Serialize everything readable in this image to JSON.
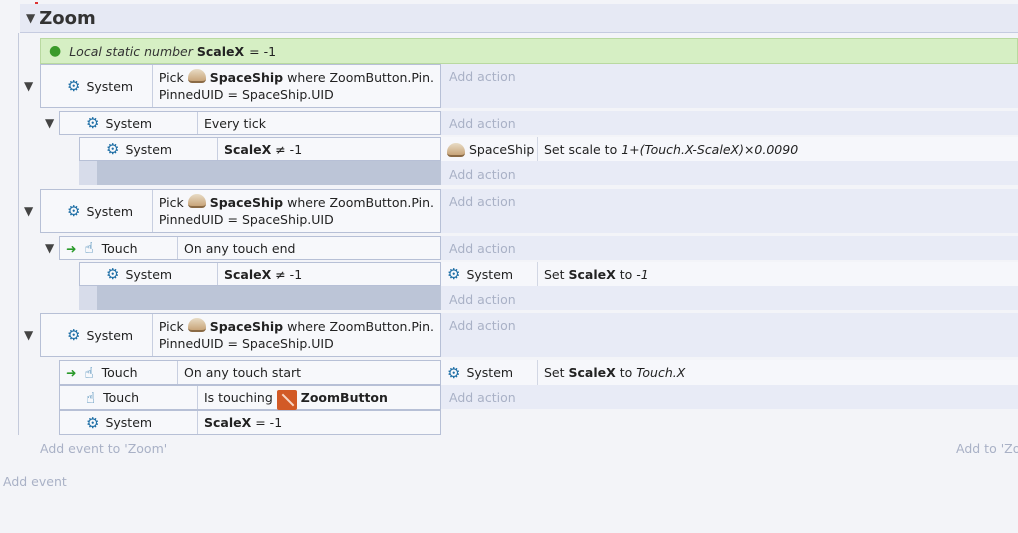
{
  "group": {
    "title": "Zoom",
    "add_event_label": "Add event to 'Zoom'",
    "add_to_label": "Add to 'Zo"
  },
  "local_var": {
    "prefix": "Local static number",
    "name": "ScaleX",
    "equals": "= -1"
  },
  "common": {
    "add_action": "Add action",
    "system": "System",
    "touch": "Touch"
  },
  "event1": {
    "pick": "Pick",
    "object": "SpaceShip",
    "where": "where ZoomButton.Pin.",
    "line2": "PinnedUID = SpaceShip.UID",
    "sub": {
      "condition": "Every tick",
      "nested": {
        "var": "ScaleX",
        "cmp": "≠ -1",
        "action_obj": "SpaceShip",
        "action_prefix": "Set scale to",
        "action_expr": "1+(Touch.X-ScaleX)×0.0090"
      }
    }
  },
  "event2": {
    "pick": "Pick",
    "object": "SpaceShip",
    "where": "where ZoomButton.Pin.",
    "line2": "PinnedUID = SpaceShip.UID",
    "sub": {
      "condition": "On any touch end",
      "nested": {
        "var": "ScaleX",
        "cmp": "≠ -1",
        "action_obj": "System",
        "action_set": "Set",
        "action_var": "ScaleX",
        "action_to": "to",
        "action_val": "-1"
      }
    }
  },
  "event3": {
    "pick": "Pick",
    "object": "SpaceShip",
    "where": "where ZoomButton.Pin.",
    "line2": "PinnedUID = SpaceShip.UID",
    "sub": {
      "cond1": "On any touch start",
      "cond2_prefix": "Is touching",
      "cond2_obj": "ZoomButton",
      "cond3_var": "ScaleX",
      "cond3_cmp": "= -1",
      "action_obj": "System",
      "action_set": "Set",
      "action_var": "ScaleX",
      "action_to": "to",
      "action_val": "Touch.X"
    }
  },
  "footer": {
    "add_event": "Add event"
  },
  "icons": [
    "expand-triangle-icon",
    "pin-icon",
    "gear-icon",
    "touch-hand-icon",
    "trigger-arrow-icon",
    "spaceship-icon",
    "zoombutton-icon"
  ],
  "colors": {
    "local_var_bg": "#d6efc4",
    "gear_blue": "#1f6fa6",
    "trigger_green": "#2a9a2a",
    "zoombutton": "#d25a26"
  }
}
